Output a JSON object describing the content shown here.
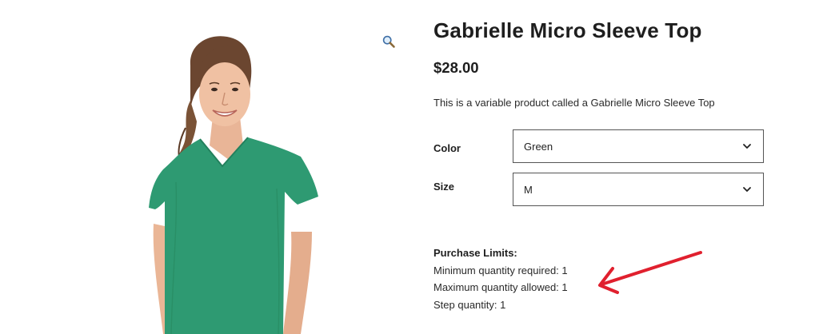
{
  "product": {
    "title": "Gabrielle Micro Sleeve Top",
    "price": "$28.00",
    "description": "This is a variable product called a Gabrielle Micro Sleeve Top",
    "garment_color": "#2e9a72"
  },
  "variations": {
    "color": {
      "label": "Color",
      "selected": "Green"
    },
    "size": {
      "label": "Size",
      "selected": "M"
    }
  },
  "purchase_limits": {
    "title": "Purchase Limits:",
    "min_line": "Minimum quantity required: 1",
    "max_line": "Maximum quantity allowed: 1",
    "step_line": "Step quantity: 1"
  },
  "icons": {
    "zoom": "magnifier-icon",
    "dropdown": "chevron-down-icon",
    "annotation": "red-arrow"
  },
  "colors": {
    "annotation": "#e0202e",
    "text": "#1e1e1e"
  }
}
